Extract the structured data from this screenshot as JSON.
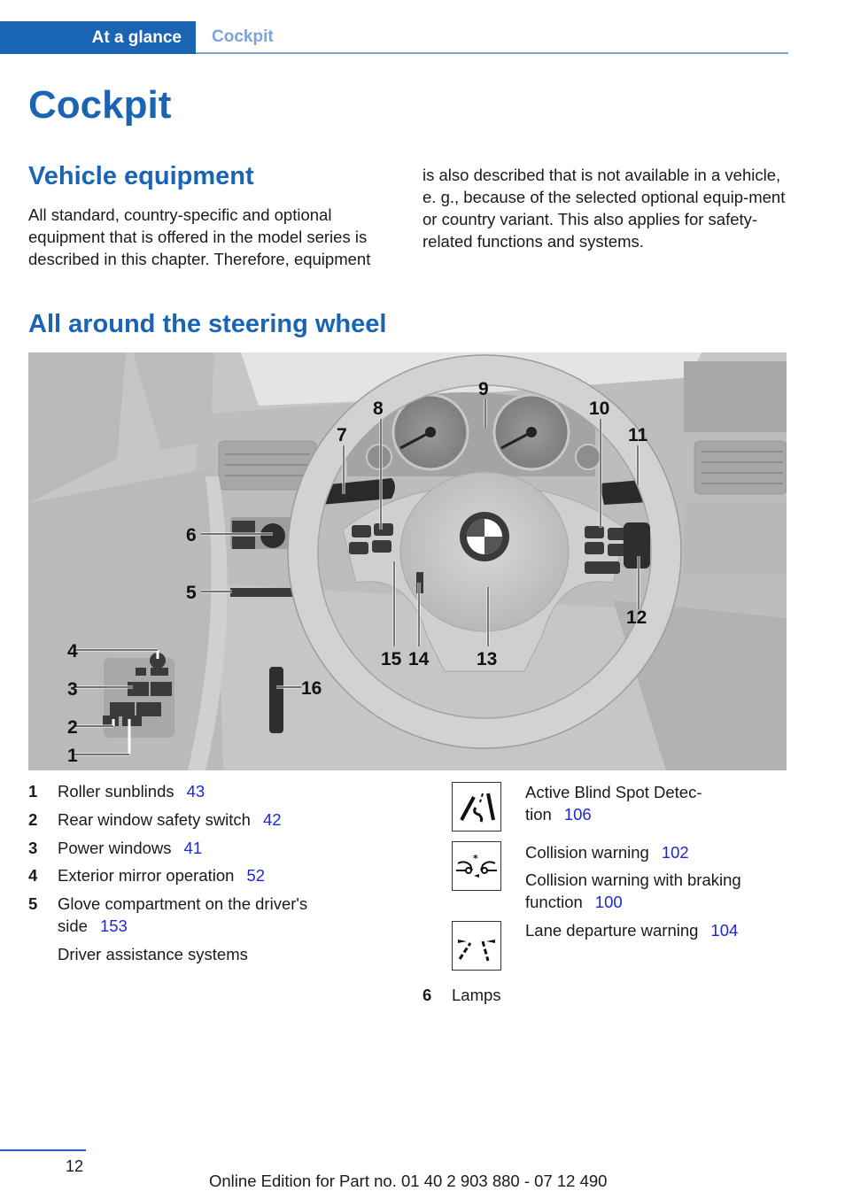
{
  "header": {
    "section_tab": "At a glance",
    "breadcrumb": "Cockpit"
  },
  "page_title": "Cockpit",
  "vehicle_equipment": {
    "heading": "Vehicle equipment",
    "paragraph_left": "All standard, country-specific and optional equipment that is offered in the model series is described in this chapter. Therefore, equipment",
    "paragraph_right": "is also described that is not available in a vehicle, e. g., because of the selected optional equip-ment or country variant. This also applies for safety-related functions and systems."
  },
  "steering_section": {
    "heading": "All around the steering wheel",
    "illustration": {
      "description": "Grayscale illustration of driver's cockpit with numbered callouts",
      "logo_text": "BMW",
      "callouts": [
        "1",
        "2",
        "3",
        "4",
        "5",
        "6",
        "7",
        "8",
        "9",
        "10",
        "11",
        "12",
        "13",
        "14",
        "15",
        "16"
      ]
    }
  },
  "legend_left": [
    {
      "num": "1",
      "label": "Roller sunblinds",
      "page": "43"
    },
    {
      "num": "2",
      "label": "Rear window safety switch",
      "page": "42"
    },
    {
      "num": "3",
      "label": "Power windows",
      "page": "41"
    },
    {
      "num": "4",
      "label": "Exterior mirror operation",
      "page": "52"
    },
    {
      "num": "5",
      "label_line1": "Glove compartment on the driver's",
      "label_line2": "side",
      "page": "153"
    }
  ],
  "driver_assistance": {
    "label": "Driver assistance systems",
    "items": [
      {
        "icon": "blind-spot-icon",
        "line1": "Active Blind Spot Detec-",
        "line2": "tion",
        "page": "106"
      },
      {
        "icon": "collision-warning-icon",
        "line1": "Collision warning",
        "page": "102",
        "extra_line1": "Collision warning with braking",
        "extra_line2": "function",
        "extra_page": "100"
      },
      {
        "icon": "lane-departure-icon",
        "line1": "Lane departure warning",
        "page": "104"
      }
    ]
  },
  "legend_right": [
    {
      "num": "6",
      "label": "Lamps"
    }
  ],
  "footer": {
    "page_number": "12",
    "edition": "Online Edition for Part no. 01 40 2 903 880 - 07 12 490"
  },
  "colors": {
    "brand_blue": "#1a64b4",
    "breadcrumb_blue": "#7ea3d8",
    "page_ref_blue": "#1c28d8"
  }
}
